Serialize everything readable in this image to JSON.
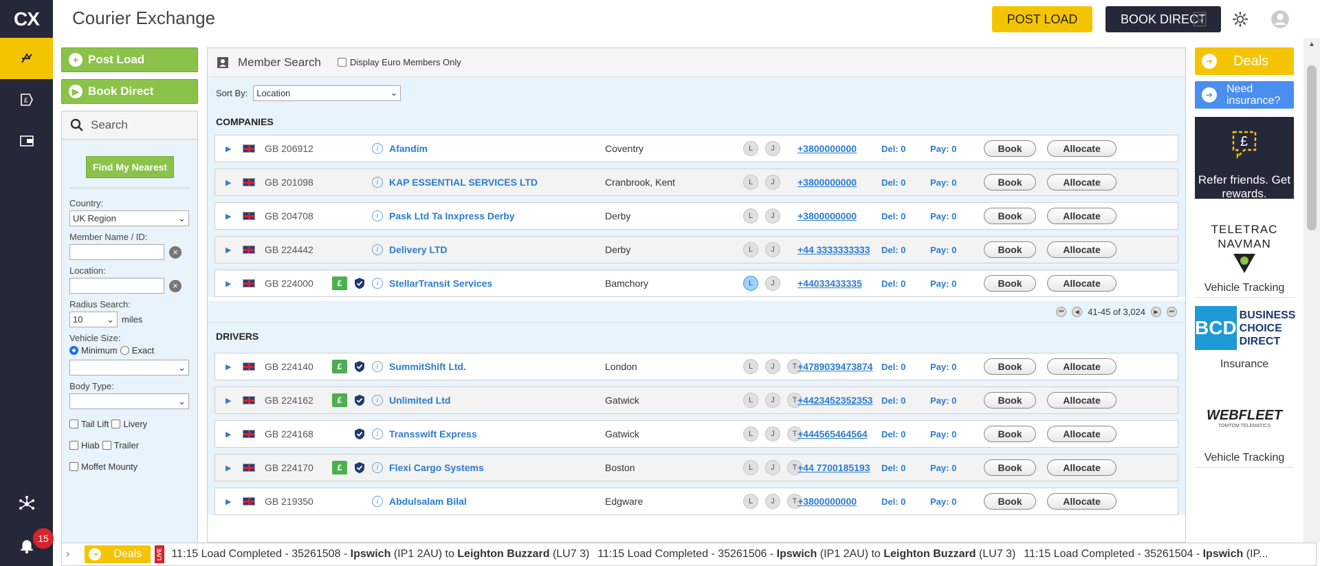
{
  "app": {
    "title": "Courier Exchange",
    "logo": "CX"
  },
  "header": {
    "post_load": "POST LOAD",
    "book_direct": "BOOK DIRECT"
  },
  "side": {
    "post_load": "Post Load",
    "book_direct": "Book Direct",
    "search": "Search",
    "find_nearest": "Find My Nearest",
    "country_label": "Country:",
    "country_value": "UK Region",
    "member_label": "Member Name / ID:",
    "location_label": "Location:",
    "radius_label": "Radius Search:",
    "radius_value": "10",
    "miles": "miles",
    "vehicle_label": "Vehicle Size:",
    "minimum": "Minimum",
    "exact": "Exact",
    "body_label": "Body Type:",
    "tail_lift": "Tail Lift",
    "livery": "Livery",
    "hiab": "Hiab",
    "trailer": "Trailer",
    "moffet": "Moffet Mounty"
  },
  "main": {
    "title": "Member Search",
    "euro_only": "Display Euro Members Only",
    "sort_label": "Sort By:",
    "sort_value": "Location",
    "companies_heading": "COMPANIES",
    "drivers_heading": "DRIVERS",
    "pager_text": "41-45 of 3,024",
    "book": "Book",
    "allocate": "Allocate"
  },
  "companies": [
    {
      "id": "GB 206912",
      "name": "Afandim",
      "location": "Coventry",
      "phone": "+3800000000",
      "del": "Del: 0",
      "pay": "Pay: 0",
      "pound": false,
      "shield": false,
      "l_active": false
    },
    {
      "id": "GB 201098",
      "name": "KAP ESSENTIAL SERVICES LTD",
      "location": "Cranbrook, Kent",
      "phone": "+3800000000",
      "del": "Del: 0",
      "pay": "Pay: 0",
      "pound": false,
      "shield": false,
      "l_active": false
    },
    {
      "id": "GB 204708",
      "name": "Pask Ltd Ta Inxpress Derby",
      "location": "Derby",
      "phone": "+3800000000",
      "del": "Del: 0",
      "pay": "Pay: 0",
      "pound": false,
      "shield": false,
      "l_active": false
    },
    {
      "id": "GB 224442",
      "name": "Delivery LTD",
      "location": "Derby",
      "phone": "+44 3333333333",
      "del": "Del: 0",
      "pay": "Pay: 0",
      "pound": false,
      "shield": false,
      "l_active": false
    },
    {
      "id": "GB 224000",
      "name": "StellarTransit Services",
      "location": "Bamchory",
      "phone": "+44033433335",
      "del": "Del: 0",
      "pay": "Pay: 0",
      "pound": true,
      "shield": true,
      "l_active": true
    }
  ],
  "drivers": [
    {
      "id": "GB 224140",
      "name": "SummitShift Ltd.",
      "location": "London",
      "phone": "+4789039473874",
      "del": "Del: 0",
      "pay": "Pay: 0",
      "pound": true,
      "shield": true
    },
    {
      "id": "GB 224162",
      "name": "Unlimited Ltd",
      "location": "Gatwick",
      "phone": "+4423452352353",
      "del": "Del: 0",
      "pay": "Pay: 0",
      "pound": true,
      "shield": true
    },
    {
      "id": "GB 224168",
      "name": "Transswift Express",
      "location": "Gatwick",
      "phone": "+444565464564",
      "del": "Del: 0",
      "pay": "Pay: 0",
      "pound": false,
      "shield": true
    },
    {
      "id": "GB 224170",
      "name": "Flexi Cargo Systems",
      "location": "Boston",
      "phone": "+44 7700185193",
      "del": "Del: 0",
      "pay": "Pay: 0",
      "pound": true,
      "shield": true
    },
    {
      "id": "GB 219350",
      "name": "Abdulsalam Bilal",
      "location": "Edgware",
      "phone": "+3800000000",
      "del": "Del: 0",
      "pay": "Pay: 0",
      "pound": false,
      "shield": false
    }
  ],
  "tags": {
    "l": "L",
    "j": "J",
    "t": "T"
  },
  "ads": {
    "deals": "Deals",
    "insurance": "Need insurance?",
    "refer": "Refer friends. Get rewards.",
    "teletrac_logo": "TELETRAC NAVMAN",
    "teletrac_caption": "Vehicle Tracking",
    "bcd_logo": "BCD",
    "bcd_name": "BUSINESS CHOICE DIRECT",
    "bcd_caption": "Insurance",
    "webfleet_logo": "WEBFLEET",
    "webfleet_sub": "TOMTOM TELEMATICS",
    "webfleet_caption": "Vehicle Tracking"
  },
  "notifications": {
    "count": "15"
  },
  "ticker": {
    "deals": "Deals",
    "live": "LIVE",
    "items": [
      {
        "time": "11:15 Load Completed - 35261508 - ",
        "from": "Ipswich",
        "from_pc": " (IP1 2AU) to ",
        "to": "Leighton Buzzard",
        "to_pc": " (LU7 3)"
      },
      {
        "time": "11:15 Load Completed - 35261506 - ",
        "from": "Ipswich",
        "from_pc": " (IP1 2AU) to ",
        "to": "Leighton Buzzard",
        "to_pc": " (LU7 3)"
      },
      {
        "time": "11:15 Load Completed - 35261504 - ",
        "from": "Ipswich",
        "from_pc": " (IP...",
        "to": "",
        "to_pc": ""
      }
    ]
  },
  "colors": {
    "accent": "#f5c400",
    "nav": "#252838",
    "green": "#8bc34a",
    "link": "#2a7bd1"
  }
}
